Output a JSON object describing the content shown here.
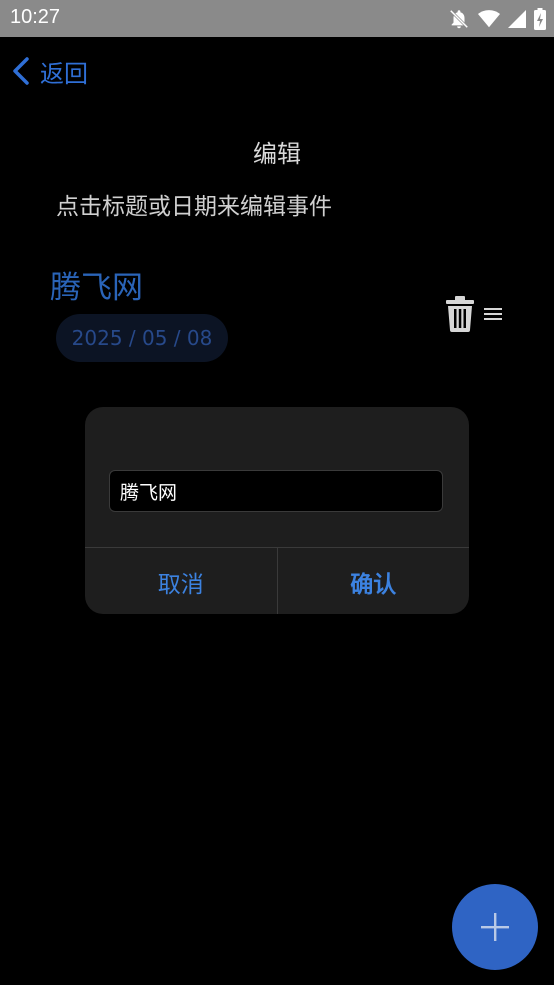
{
  "status_bar": {
    "time": "10:27",
    "icons": [
      "notifications-off-icon",
      "wifi-icon",
      "signal-icon",
      "battery-charging-icon"
    ]
  },
  "header": {
    "back_label": "返回",
    "back_icon": "chevron-left-icon"
  },
  "page": {
    "title": "编辑",
    "hint": "点击标题或日期来编辑事件"
  },
  "event": {
    "title": "腾飞网",
    "date": "2025 / 05 / 08",
    "delete_icon": "trash-icon",
    "drag_icon": "drag-handle-icon"
  },
  "dialog": {
    "input_value": "腾飞网",
    "cancel_label": "取消",
    "confirm_label": "确认"
  },
  "fab": {
    "icon": "plus-icon"
  },
  "colors": {
    "accent": "#2f6fd6",
    "fab": "#2f64c4",
    "background": "#000000",
    "dialog": "#1e1e1e"
  }
}
